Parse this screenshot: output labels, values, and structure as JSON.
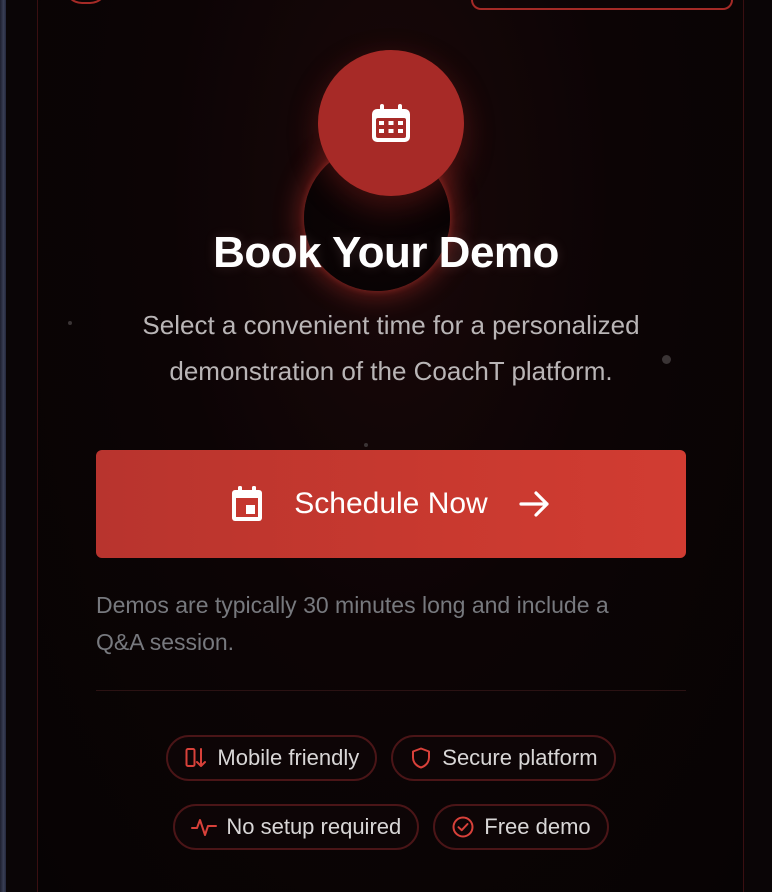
{
  "hero": {
    "title": "Book Your Demo",
    "subtitle_line1": "Select a convenient time for a personalized",
    "subtitle_line2": "demonstration of the CoachT platform.",
    "icon": "calendar-icon"
  },
  "cta": {
    "label": "Schedule Now",
    "leading_icon": "calendar-icon",
    "trailing_icon": "arrow-right-icon"
  },
  "note": {
    "line1": "Demos are typically 30 minutes long and include a",
    "line2": "Q&A session."
  },
  "badges": [
    {
      "label": "Mobile friendly",
      "icon": "mobile-icon"
    },
    {
      "label": "Secure platform",
      "icon": "shield-icon"
    },
    {
      "label": "No setup required",
      "icon": "activity-icon"
    },
    {
      "label": "Free demo",
      "icon": "check-circle-icon"
    }
  ],
  "colors": {
    "accent": "#c9392f",
    "icon_circle": "#a72a27",
    "background": "#0a0506",
    "badge_border": "#4a1517",
    "muted_text": "#77797e"
  }
}
